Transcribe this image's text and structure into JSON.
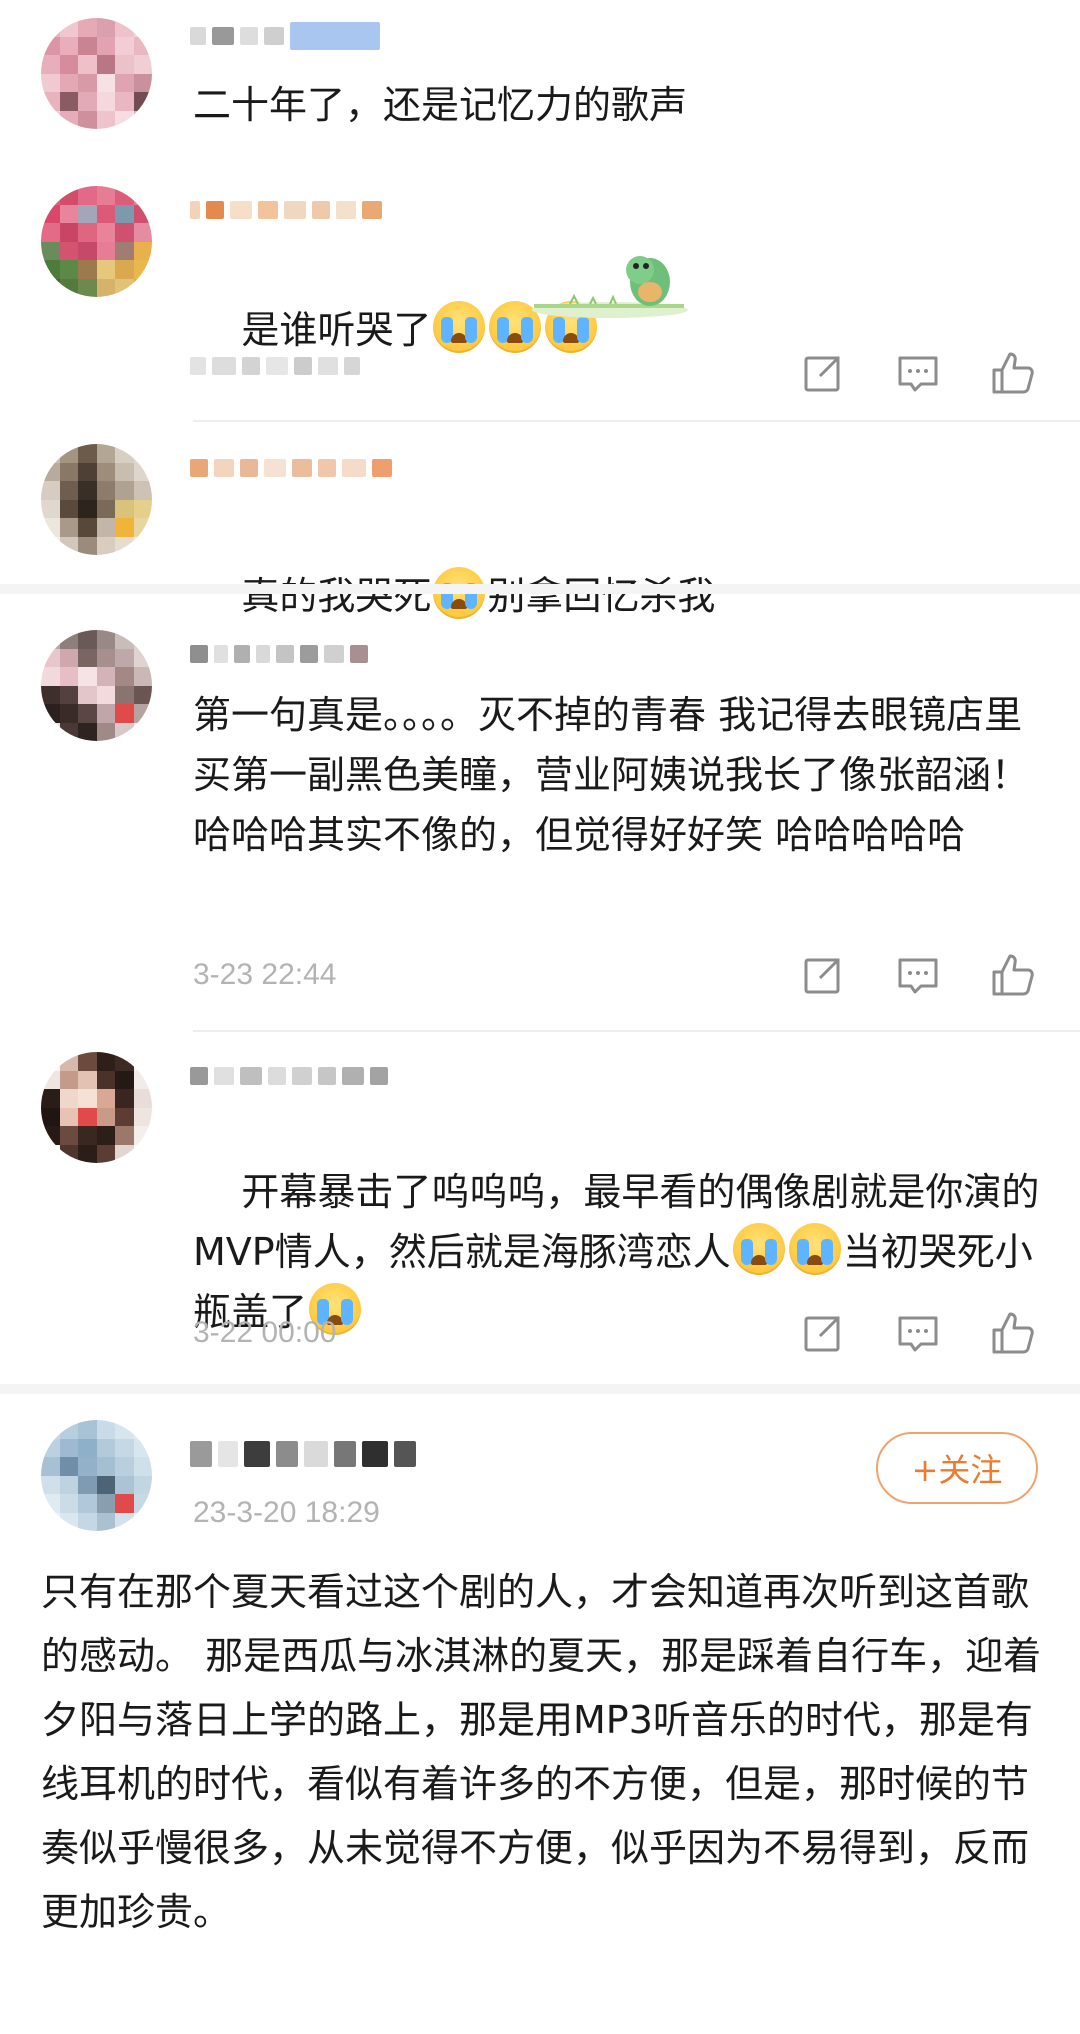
{
  "comments": [
    {
      "text": "二十年了，还是记忆力的歌声",
      "time": ""
    },
    {
      "text_before": "是谁听哭了",
      "emoji_count": 3,
      "time": ""
    },
    {
      "text_a": "真的我哭死",
      "text_b": "别拿回忆杀我",
      "time": ""
    },
    {
      "text": "第一句真是。。。。灭不掉的青春 我记得去眼镜店里买第一副黑色美瞳，营业阿姨说我长了像张韶涵！哈哈哈其实不像的，但觉得好好笑 哈哈哈哈哈",
      "time": "3-23 22:44"
    },
    {
      "text_a": "开幕暴击了呜呜呜，最早看的偶像剧就是你演的MVP情人，然后就是海豚湾恋人",
      "text_b": "当初哭死小瓶盖了",
      "time": "3-22 00:00"
    }
  ],
  "post": {
    "follow_label": "+关注",
    "time": "23-3-20 18:29",
    "text": "只有在那个夏天看过这个剧的人，才会知道再次听到这首歌的感动。 那是西瓜与冰淇淋的夏天，那是踩着自行车，迎着夕阳与落日上学的路上，那是用MP3听音乐的时代，那是有线耳机的时代，看似有着许多的不方便，但是，那时候的节奏似乎慢很多，从未觉得不方便，似乎因为不易得到，反而更加珍贵。"
  },
  "icons": [
    "share-icon",
    "comment-icon",
    "like-icon",
    "cry-emoji"
  ],
  "colors": {
    "accent": "#ed7a2e",
    "meta": "#b3b3b3",
    "divider": "#eeeeee"
  }
}
